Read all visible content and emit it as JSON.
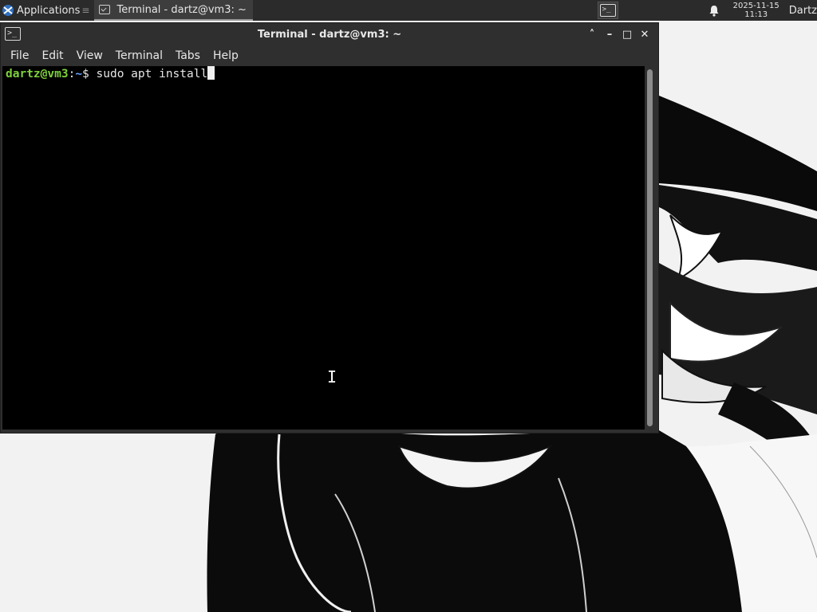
{
  "panel": {
    "applications_label": "Applications",
    "separator": "≡",
    "task_title": "Terminal - dartz@vm3: ~",
    "clock_date": "2025-11-15",
    "clock_time": "11:13",
    "user": "Dartz",
    "launcher_glyph": ">_"
  },
  "window": {
    "title": "Terminal - dartz@vm3: ~",
    "app_icon_glyph": ">_",
    "buttons": {
      "shade": "˄",
      "minimize": "–",
      "maximize": "□",
      "close": "✕"
    }
  },
  "menubar": {
    "items": [
      "File",
      "Edit",
      "View",
      "Terminal",
      "Tabs",
      "Help"
    ]
  },
  "terminal": {
    "prompt_user": "dartz@vm3",
    "prompt_sep": ":",
    "prompt_path": "~",
    "prompt_symbol": "$ ",
    "command": "sudo apt install"
  },
  "colors": {
    "panel_bg": "#2b2b2b",
    "window_bg": "#2f2f2f",
    "terminal_bg": "#000000",
    "prompt_user": "#7fd13b",
    "prompt_path": "#6aa0ff"
  },
  "icons": {
    "apps_logo": "xfce-logo-icon",
    "notification": "bell-icon",
    "terminal": "terminal-icon"
  }
}
